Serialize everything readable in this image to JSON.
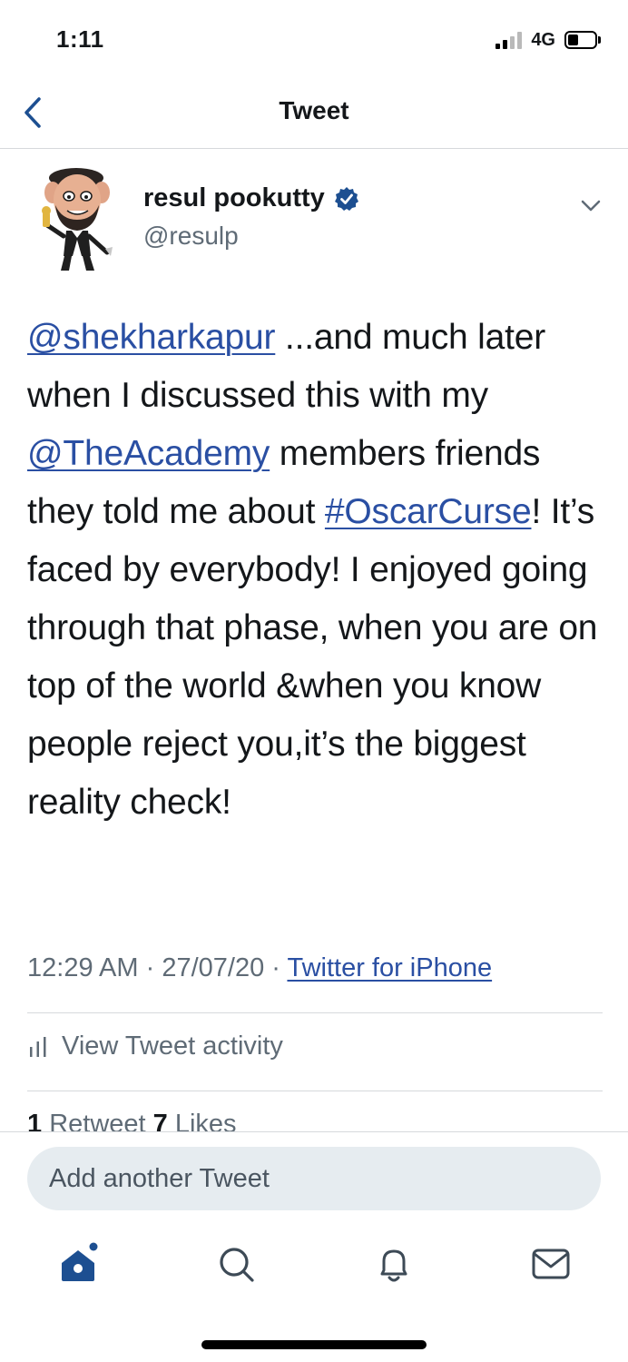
{
  "status_bar": {
    "time": "1:11",
    "network": "4G"
  },
  "header": {
    "title": "Tweet"
  },
  "author": {
    "display_name": "resul pookutty",
    "handle": "@resulp",
    "verified": true
  },
  "tweet": {
    "mention_1": "@shekharkapur",
    "text_1": " ...and much later when I discussed this with my ",
    "mention_2": "@TheAcademy",
    "text_2": " members friends they told me about ",
    "hashtag": "#OscarCurse",
    "text_3": "! It’s faced by everybody! I enjoyed going through that phase, when you are on top of the world &when you know people reject you,it’s the biggest reality check!"
  },
  "meta": {
    "time": "12:29 AM",
    "separator": " · ",
    "date": "27/07/20",
    "source": "Twitter for iPhone"
  },
  "activity": {
    "label": "View Tweet activity"
  },
  "engagement": {
    "retweet_count": "1",
    "retweet_label": " Retweet  ",
    "like_count": "7",
    "like_label": " Likes"
  },
  "composer": {
    "placeholder": "Add another Tweet"
  },
  "colors": {
    "link": "#2a4fa3",
    "accent": "#1d4f91",
    "muted": "#5f6b76",
    "divider": "#d6d9dc"
  }
}
